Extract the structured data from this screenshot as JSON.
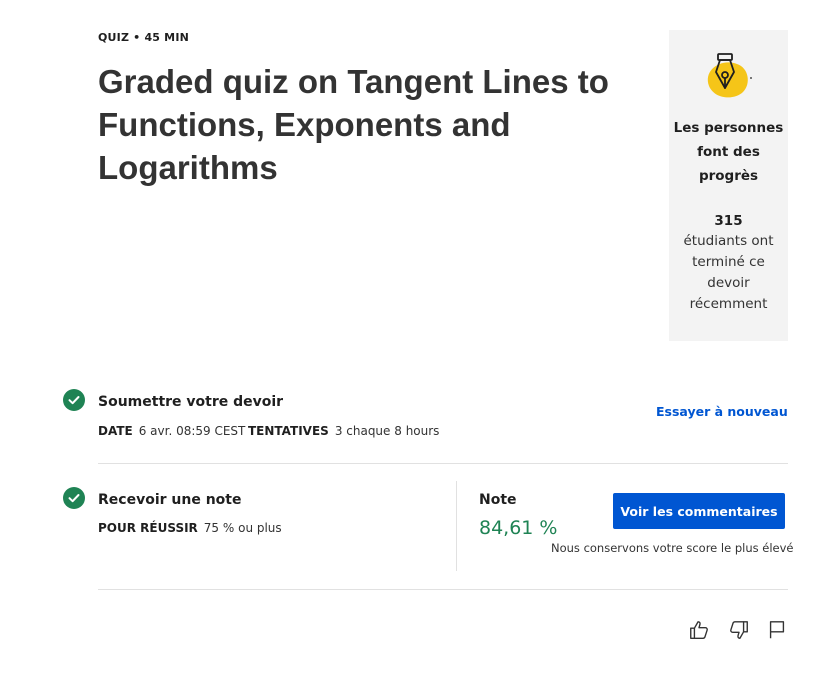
{
  "header": {
    "meta": "QUIZ • 45  MIN",
    "title": "Graded quiz on Tangent Lines to Functions, Exponents and Logarithms"
  },
  "progress_card": {
    "icon": "fountain-pen-nib-icon",
    "heading": "Les personnes font des progrès",
    "count": "315",
    "description": "étudiants ont terminé ce devoir récemment"
  },
  "submit_step": {
    "title": "Soumettre votre devoir",
    "date_label": "DATE",
    "date_value": "6 avr. 08:59 CEST",
    "attempts_label": "TENTATIVES",
    "attempts_value": "3 chaque 8  hours",
    "retry_link": "Essayer à nouveau"
  },
  "grade_step": {
    "title": "Recevoir une note",
    "pass_label": "POUR RÉUSSIR",
    "pass_value": "75 % ou plus",
    "grade_label": "Note",
    "grade_value": "84,61 %",
    "feedback_button": "Voir les commentaires",
    "keep_note": "Nous conservons votre score le plus élevé"
  },
  "feedback_icons": [
    "thumbs-up-icon",
    "thumbs-down-icon",
    "flag-icon"
  ],
  "colors": {
    "primary": "#0056d2",
    "success": "#1f8354",
    "card_bg": "#f3f3f3",
    "accent_yellow": "#f5c518"
  }
}
